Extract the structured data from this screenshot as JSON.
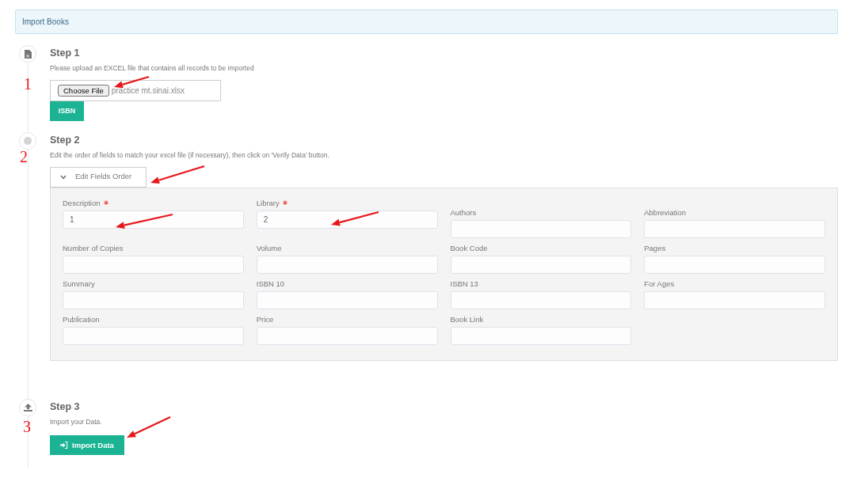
{
  "header": {
    "title": "Import Books"
  },
  "steps": [
    {
      "kind": "file",
      "title": "Step 1",
      "description": "Please upload an EXCEL file that contains all records to be imported",
      "file_input": {
        "button": "Choose File",
        "value": "practice mt.sinai.xlsx"
      },
      "button": "ISBN"
    },
    {
      "kind": "fields",
      "title": "Step 2",
      "description": "Edit the order of fields to match your excel file (if necessary), then click on 'Verify Data' button.",
      "toggle": {
        "label": "Edit Fields Order",
        "expanded": true
      },
      "fields": [
        {
          "label": "Description",
          "required": true,
          "value": "1"
        },
        {
          "label": "Library",
          "required": true,
          "value": "2"
        },
        {
          "label": "Authors",
          "required": false
        },
        {
          "label": "Abbreviation",
          "required": false
        },
        {
          "label": "Number of Copies",
          "required": false
        },
        {
          "label": "Volume",
          "required": false
        },
        {
          "label": "Book Code",
          "required": false
        },
        {
          "label": "Pages",
          "required": false
        },
        {
          "label": "Summary",
          "required": false
        },
        {
          "label": "ISBN 10",
          "required": false
        },
        {
          "label": "ISBN 13",
          "required": false
        },
        {
          "label": "For Ages",
          "required": false
        },
        {
          "label": "Publication",
          "required": false
        },
        {
          "label": "Price",
          "required": false
        },
        {
          "label": "Book Link",
          "required": false
        }
      ]
    },
    {
      "kind": "import",
      "title": "Step 3",
      "description": "Import your Data.",
      "button": "Import Data"
    }
  ],
  "annotations": [
    {
      "label": "1"
    },
    {
      "label": "2"
    },
    {
      "label": "3"
    }
  ]
}
